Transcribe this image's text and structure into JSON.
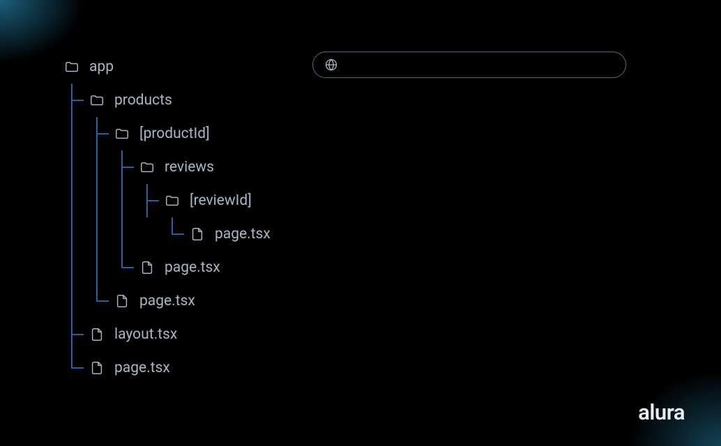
{
  "tree": {
    "root": "app",
    "products": "products",
    "productId": "[productId]",
    "reviews": "reviews",
    "reviewId": "[reviewId]",
    "page_tsx_6": "page.tsx",
    "page_tsx_5": "page.tsx",
    "page_tsx_4": "page.tsx",
    "layout_tsx": "layout.tsx",
    "page_tsx_root": "page.tsx"
  },
  "urlbar": {
    "value": ""
  },
  "brand": {
    "name": "alura"
  }
}
